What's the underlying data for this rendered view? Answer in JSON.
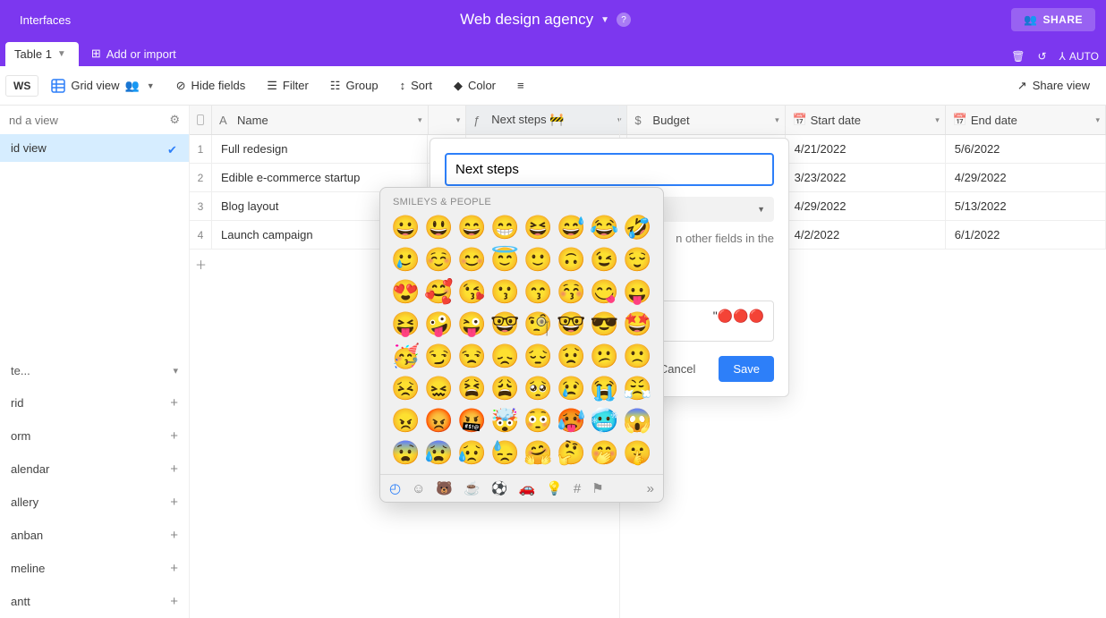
{
  "header": {
    "interfaces": "Interfaces",
    "title": "Web design agency",
    "share": "SHARE",
    "auto": "AUTO"
  },
  "tabs": {
    "table1": "Table 1",
    "add_or_import": "Add or import"
  },
  "toolbar": {
    "ws": "WS",
    "grid_view": "Grid view",
    "hide_fields": "Hide fields",
    "filter": "Filter",
    "group": "Group",
    "sort": "Sort",
    "color": "Color",
    "share_view": "Share view"
  },
  "sidebar": {
    "find_placeholder": "nd a view",
    "grid_view": "id view",
    "create": "te...",
    "opts": [
      "rid",
      "orm",
      "alendar",
      "allery",
      "anban",
      "meline",
      "antt"
    ]
  },
  "columns": {
    "name": "Name",
    "next_steps": "Next steps 🚧",
    "budget": "Budget",
    "start_date": "Start date",
    "end_date": "End date"
  },
  "rows": [
    {
      "n": "1",
      "name": "Full redesign",
      "start": "4/21/2022",
      "end": "5/6/2022"
    },
    {
      "n": "2",
      "name": "Edible e-commerce startup",
      "start": "3/23/2022",
      "end": "4/29/2022"
    },
    {
      "n": "3",
      "name": "Blog layout",
      "start": "4/29/2022",
      "end": "5/13/2022"
    },
    {
      "n": "4",
      "name": "Launch campaign",
      "start": "4/2/2022",
      "end": "6/1/2022"
    }
  ],
  "popover": {
    "field_name": "Next steps",
    "desc": "n other fields in the",
    "formula_tail": "\"🔴🔴🔴",
    "cancel": "Cancel",
    "save": "Save"
  },
  "emoji": {
    "category": "SMILEYS & PEOPLE",
    "grid": [
      "😀",
      "😃",
      "😄",
      "😁",
      "😆",
      "😅",
      "😂",
      "🤣",
      "🥲",
      "☺️",
      "😊",
      "😇",
      "🙂",
      "🙃",
      "😉",
      "😌",
      "😍",
      "🥰",
      "😘",
      "😗",
      "😙",
      "😚",
      "😋",
      "😛",
      "😝",
      "🤪",
      "😜",
      "🤓",
      "🧐",
      "🤓",
      "😎",
      "🤩",
      "🥳",
      "😏",
      "😒",
      "😞",
      "😔",
      "😟",
      "😕",
      "🙁",
      "😣",
      "😖",
      "😫",
      "😩",
      "🥺",
      "😢",
      "😭",
      "😤",
      "😠",
      "😡",
      "🤬",
      "🤯",
      "😳",
      "🥵",
      "🥶",
      "😱",
      "😨",
      "😰",
      "😥",
      "😓",
      "🤗",
      "🤔",
      "🤭",
      "🤫"
    ]
  }
}
